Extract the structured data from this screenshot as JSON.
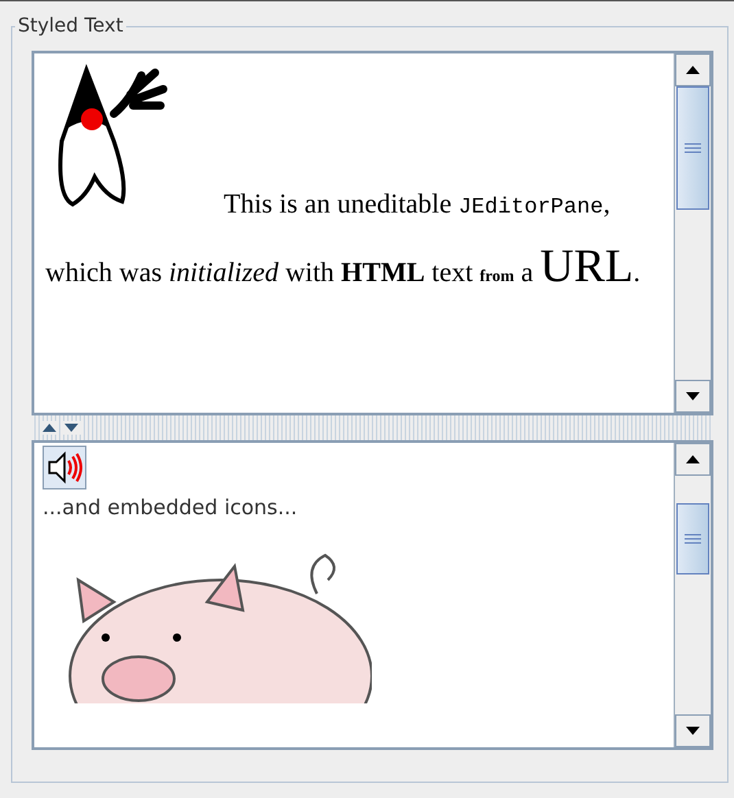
{
  "panel": {
    "title": "Styled Text"
  },
  "editor_pane": {
    "segments": [
      {
        "kind": "text",
        "text": "This is an uneditable "
      },
      {
        "kind": "code",
        "text": "JEditorPane"
      },
      {
        "kind": "text",
        "text": ", which was "
      },
      {
        "kind": "italic",
        "text": "initialized"
      },
      {
        "kind": "text",
        "text": " with "
      },
      {
        "kind": "bold",
        "text": "HTML"
      },
      {
        "kind": "text",
        "text": " text "
      },
      {
        "kind": "small",
        "text": "from"
      },
      {
        "kind": "text",
        "text": " a "
      },
      {
        "kind": "large",
        "text": "URL"
      },
      {
        "kind": "text",
        "text": "."
      }
    ]
  },
  "icon_pane": {
    "caption": "...and embedded icons..."
  }
}
